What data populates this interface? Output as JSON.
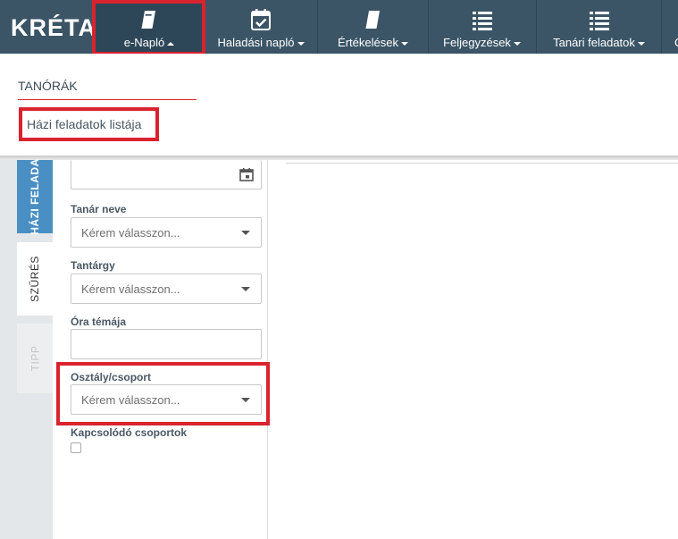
{
  "brand": {
    "logo_text": "KRÉTA"
  },
  "nav": {
    "items": [
      {
        "label": "e-Napló",
        "icon": "book-icon",
        "caret": "up"
      },
      {
        "label": "Haladási napló",
        "icon": "calendar-check-icon",
        "caret": "down"
      },
      {
        "label": "Értékelések",
        "icon": "book-icon",
        "caret": "down"
      },
      {
        "label": "Feljegyzések",
        "icon": "list-icon",
        "caret": "down"
      },
      {
        "label": "Tanári feladatok",
        "icon": "list-icon",
        "caret": "down"
      },
      {
        "label": "C",
        "icon": "",
        "caret": ""
      }
    ]
  },
  "dropdown": {
    "section_title": "TANÓRÁK",
    "link": "Házi feladatok listája"
  },
  "side_tabs": {
    "tab1": "HÁZI FELADA",
    "tab2": "SZŰRÉS",
    "tab3": "TIPP"
  },
  "filters": {
    "teacher_label": "Tanár neve",
    "teacher_placeholder": "Kérem válasszon...",
    "subject_label": "Tantárgy",
    "subject_placeholder": "Kérem válasszon...",
    "topic_label": "Óra témája",
    "class_label": "Osztály/csoport",
    "class_placeholder": "Kérem válasszon...",
    "related_groups_label": "Kapcsolódó csoportok"
  },
  "colors": {
    "topnav": "#3b5566",
    "highlight": "#d9232e",
    "tab_blue": "#4a8fc4"
  }
}
